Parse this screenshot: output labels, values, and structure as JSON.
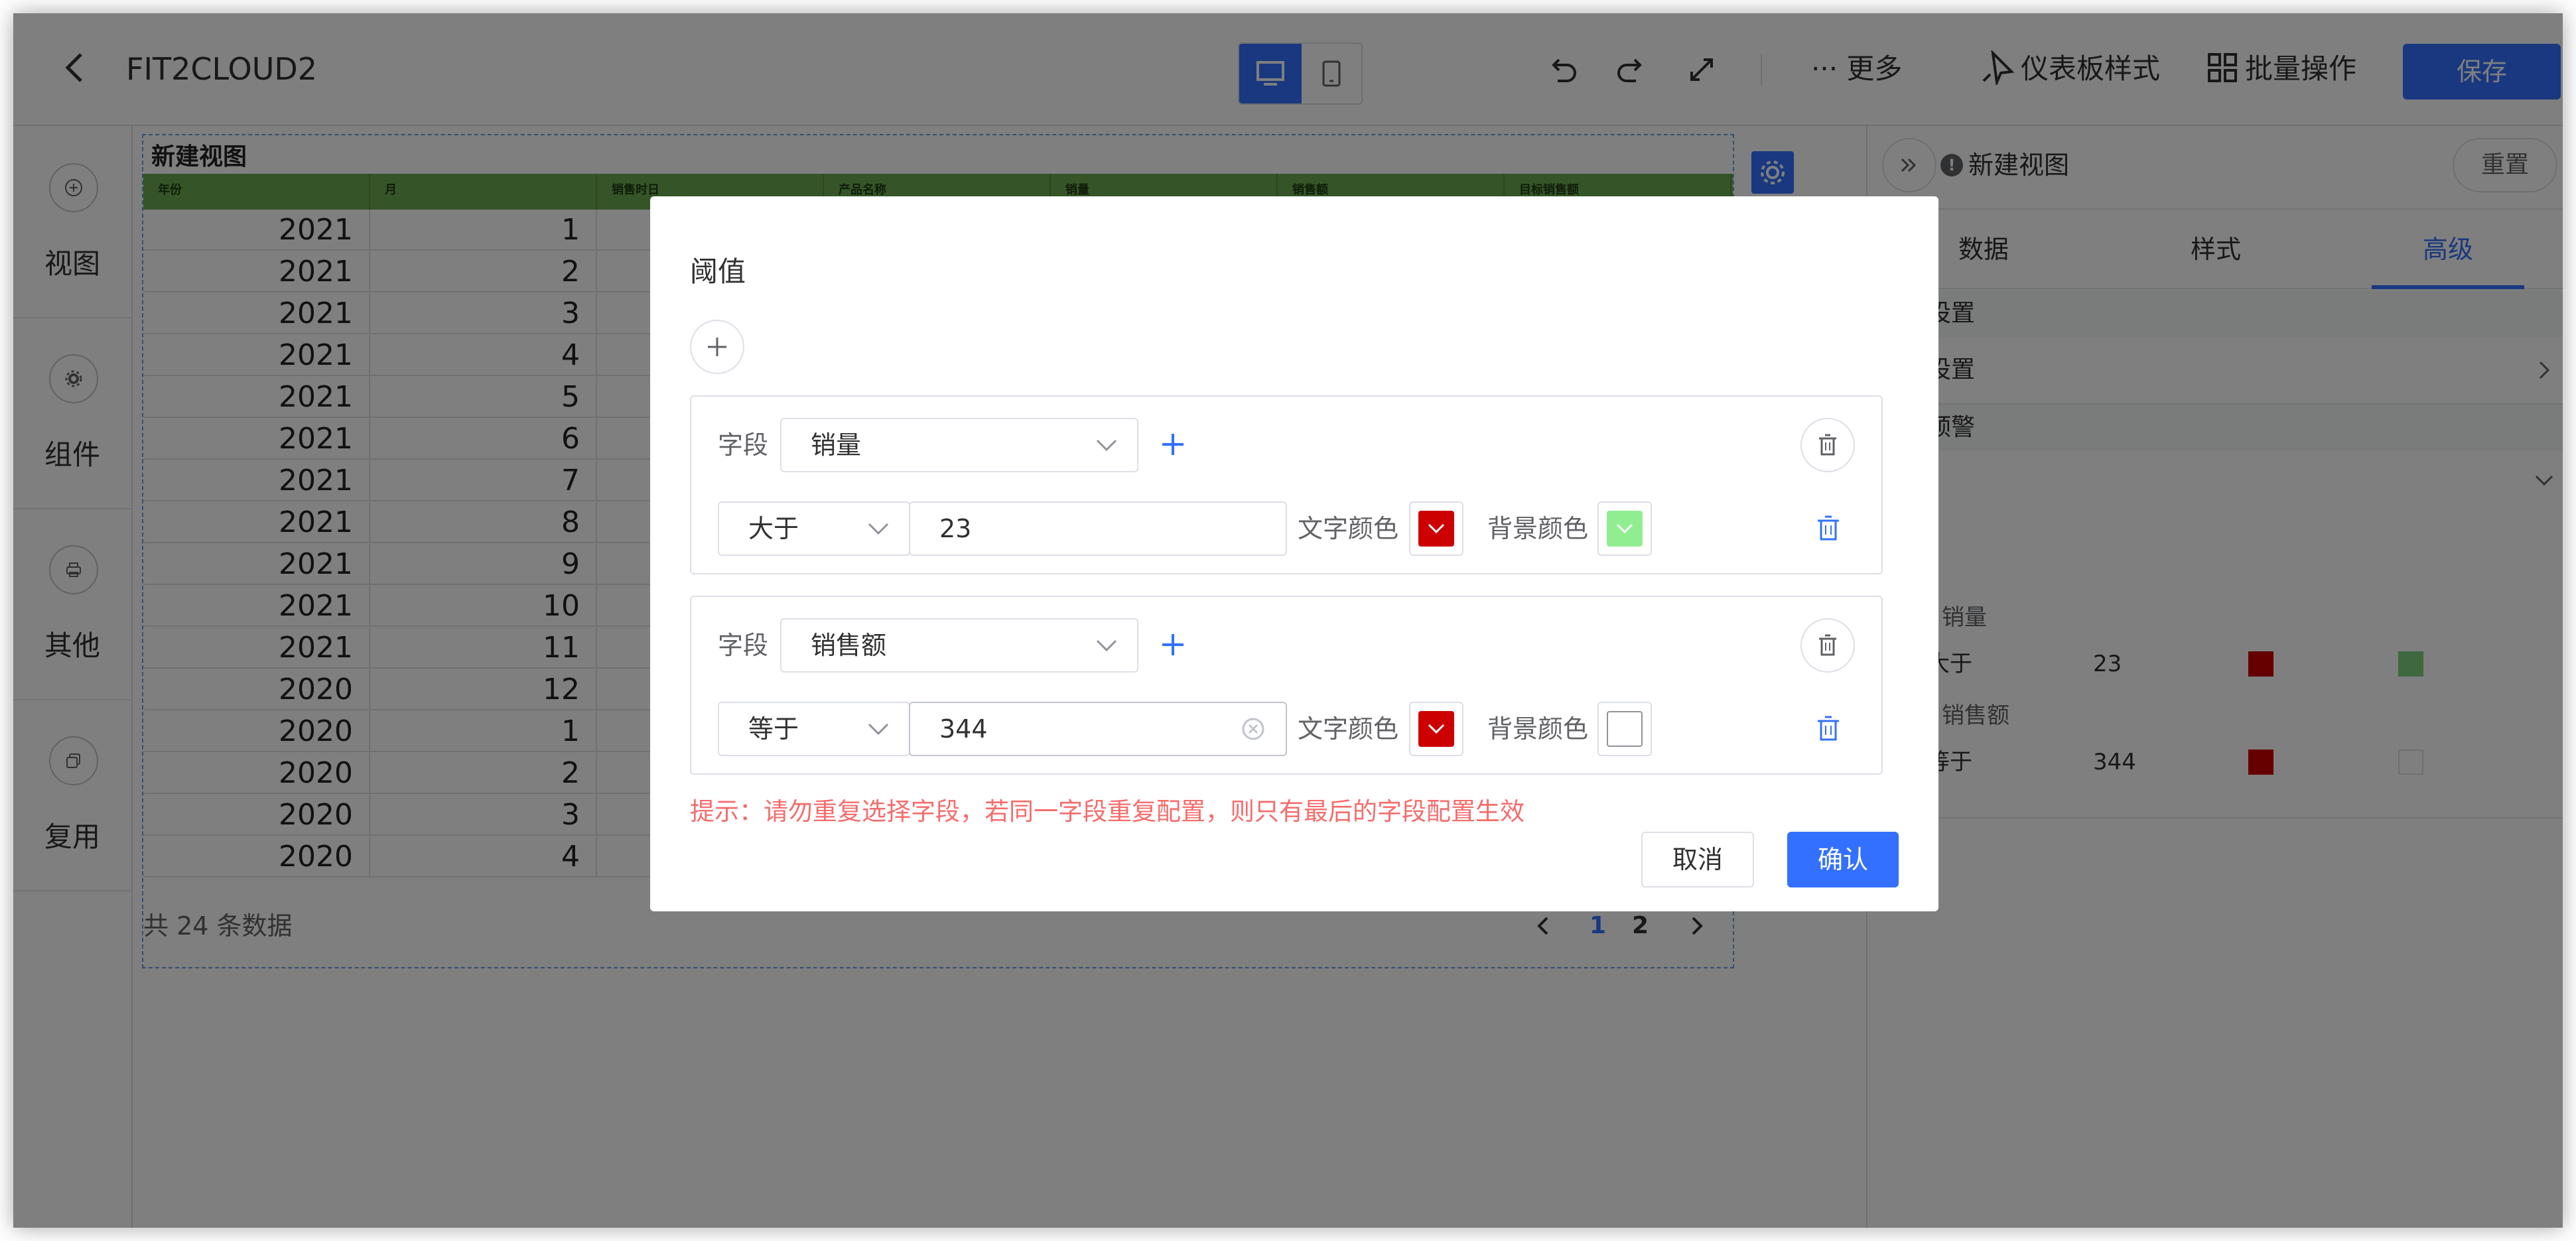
{
  "header": {
    "back_icon": "chevron-left-icon",
    "title": "FIT2CLOUD2",
    "more_label": "··· 更多",
    "dashboard_style_label": "仪表板样式",
    "batch_label": "批量操作",
    "save_label": "保存"
  },
  "sidebar": {
    "items": [
      {
        "label": "视图",
        "icon": "plus-circle-icon"
      },
      {
        "label": "组件",
        "icon": "gear-icon"
      },
      {
        "label": "其他",
        "icon": "printer-icon"
      },
      {
        "label": "复用",
        "icon": "copy-icon"
      }
    ]
  },
  "table": {
    "title": "新建视图",
    "columns": [
      "年份",
      "月",
      "销售时日",
      "产品名称",
      "销量",
      "销售额",
      "目标销售额"
    ],
    "rows": [
      {
        "year": "2021",
        "month": "1"
      },
      {
        "year": "2021",
        "month": "2"
      },
      {
        "year": "2021",
        "month": "3"
      },
      {
        "year": "2021",
        "month": "4"
      },
      {
        "year": "2021",
        "month": "5"
      },
      {
        "year": "2021",
        "month": "6"
      },
      {
        "year": "2021",
        "month": "7"
      },
      {
        "year": "2021",
        "month": "8"
      },
      {
        "year": "2021",
        "month": "9"
      },
      {
        "year": "2021",
        "month": "10"
      },
      {
        "year": "2021",
        "month": "11"
      },
      {
        "year": "2020",
        "month": "12"
      },
      {
        "year": "2020",
        "month": "1"
      },
      {
        "year": "2020",
        "month": "2"
      },
      {
        "year": "2020",
        "month": "3"
      },
      {
        "year": "2020",
        "month": "4"
      }
    ],
    "total_text": "共 24 条数据",
    "pages": [
      "1",
      "2"
    ],
    "current_page": "1",
    "header_color": "#6aa84f"
  },
  "right_panel": {
    "view_name": "新建视图",
    "reset_label": "重置",
    "tabs": [
      "数据",
      "样式",
      "高级"
    ],
    "active_tab": "高级",
    "section1": "设置",
    "row1": "设置",
    "section2": "预警",
    "summary": [
      {
        "field": "销量",
        "op": "大于",
        "value": "23",
        "text_color": "#cc0000",
        "bg_color": "#7fd17f"
      },
      {
        "field": "销售额",
        "op": "等于",
        "value": "344",
        "text_color": "#cc0000",
        "bg_color": "#ffffff"
      }
    ],
    "hash": "#"
  },
  "dialog": {
    "title": "阈值",
    "field_label": "字段",
    "text_color_label": "文字颜色",
    "bg_color_label": "背景颜色",
    "rules": [
      {
        "field": "销量",
        "op": "大于",
        "value": "23",
        "text_color": "#cc0000",
        "bg_color": "#90ee90"
      },
      {
        "field": "销售额",
        "op": "等于",
        "value": "344",
        "text_color": "#cc0000",
        "bg_color": "#ffffff"
      }
    ],
    "hint": "提示：请勿重复选择字段，若同一字段重复配置，则只有最后的字段配置生效",
    "cancel_label": "取消",
    "confirm_label": "确认"
  },
  "colors": {
    "primary": "#3370ff",
    "danger_text": "#f56c6c",
    "overlay": "rgba(0,0,0,0.5)"
  }
}
